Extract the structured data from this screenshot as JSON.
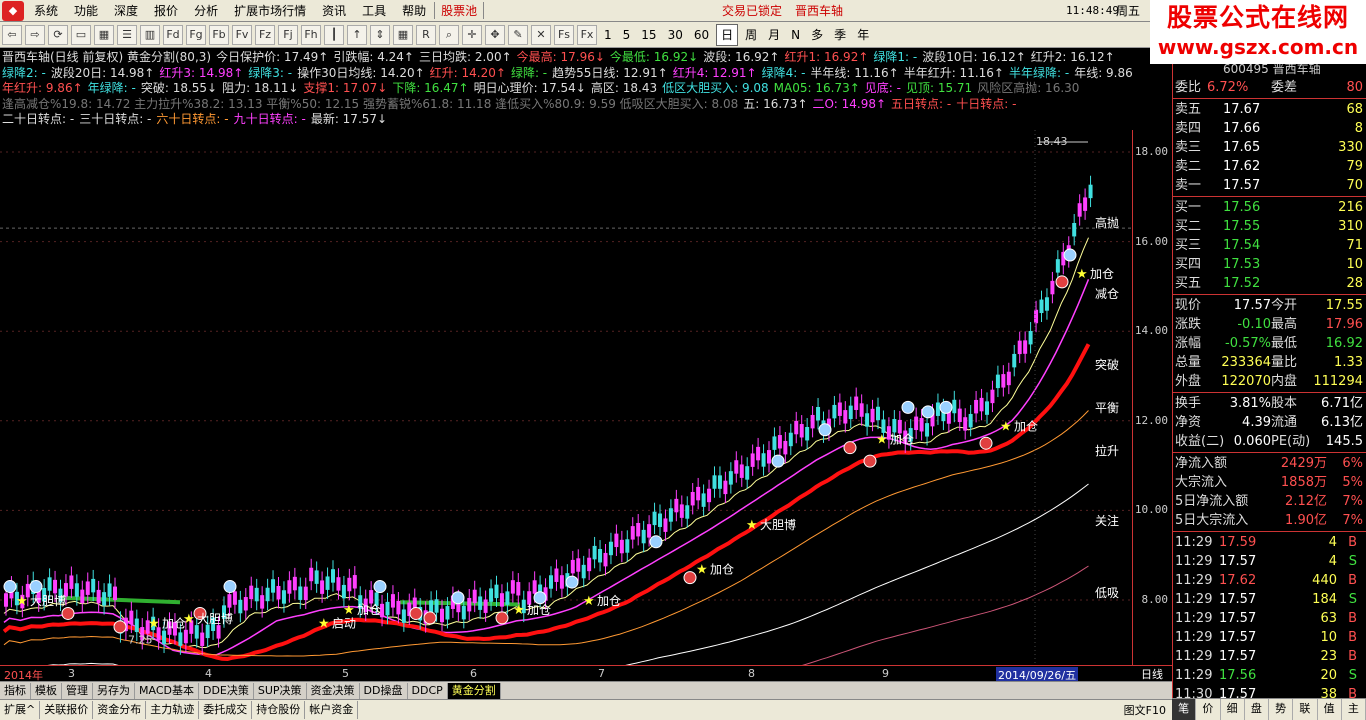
{
  "menubar": {
    "items": [
      "系统",
      "功能",
      "深度",
      "报价",
      "分析",
      "扩展市场行情",
      "资讯",
      "工具",
      "帮助"
    ],
    "stock_pool": "股票池",
    "trade_lock": "交易已锁定",
    "stock_name": "晋西车轴",
    "clock": "11:48:49",
    "weekday": "周五"
  },
  "brand": {
    "line1": "股票公式在线网",
    "line2": "www.gszx.com.cn",
    "code": "600495 晋西车轴"
  },
  "toolbar": {
    "icons": [
      "back-icon",
      "forward-icon",
      "refresh-icon",
      "window-icon",
      "grid-icon",
      "list-icon",
      "chart-icon",
      "fd-icon",
      "fg-icon",
      "fb-icon",
      "fv-icon",
      "fz-icon",
      "fj-icon",
      "fh-icon",
      "candle-icon",
      "up-arrow-icon",
      "scale-icon",
      "grid4-icon",
      "rsi-icon",
      "magnify-icon",
      "cross-icon",
      "move-icon",
      "pencil-icon",
      "x-icon",
      "fs-icon",
      "fx-icon"
    ],
    "periods": [
      "1",
      "5",
      "15",
      "30",
      "60",
      "日",
      "周",
      "月",
      "N",
      "多",
      "季",
      "年"
    ],
    "selected_period": "日"
  },
  "header": {
    "line1": [
      [
        "w",
        "晋西车轴(日线 前复权) 黄金分割(80,3)"
      ],
      [
        "w",
        "今日保护价: 17.49↑"
      ],
      [
        "w",
        "引跌幅: 4.24↑"
      ],
      [
        "w",
        "三日均跌: 2.00↑"
      ],
      [
        "r",
        "今最高: 17.96↓"
      ],
      [
        "g",
        "今最低: 16.92↓"
      ],
      [
        "w",
        "波段: 16.92↑"
      ],
      [
        "r",
        "红升1: 16.92↑"
      ],
      [
        "c",
        "绿降1: -"
      ],
      [
        "w",
        "波段10日: 16.12↑"
      ],
      [
        "w",
        "红升2: 16.12↑"
      ]
    ],
    "line2": [
      [
        "c",
        "绿降2: -"
      ],
      [
        "w",
        "波段20日: 14.98↑"
      ],
      [
        "m",
        "红升3: 14.98↑"
      ],
      [
        "c",
        "绿降3: -"
      ],
      [
        "w",
        "操作30日均线: 14.20↑"
      ],
      [
        "r",
        "红升: 14.20↑"
      ],
      [
        "g",
        "绿降: -"
      ],
      [
        "w",
        "趋势55日线: 12.91↑"
      ],
      [
        "m",
        "红升4: 12.91↑"
      ],
      [
        "c",
        "绿降4: -"
      ],
      [
        "w",
        "半年线: 11.16↑"
      ],
      [
        "w",
        "半年红升: 11.16↑"
      ],
      [
        "c",
        "半年绿降: -"
      ],
      [
        "w",
        "年线: 9.86"
      ]
    ],
    "line3": [
      [
        "r",
        "年红升: 9.86↑"
      ],
      [
        "c",
        "年绿降: -"
      ],
      [
        "w",
        "突破: 18.55↓"
      ],
      [
        "w",
        "阻力: 18.11↓"
      ],
      [
        "r",
        "支撑1: 17.07↓"
      ],
      [
        "g",
        "下降: 16.47↑"
      ],
      [
        "w",
        "明日心理价: 17.54↓"
      ],
      [
        "w",
        "高区: 18.43"
      ],
      [
        "c",
        "低区大胆买入: 9.08"
      ],
      [
        "g",
        "MA05: 16.73↑"
      ],
      [
        "m",
        "见底: -"
      ],
      [
        "g",
        "见顶: 15.71"
      ],
      [
        "gr",
        "风险区高抛: 16.30"
      ]
    ],
    "line4": [
      [
        "gr",
        "逢高减仓%19.8: 14.72 主力拉升%38.2: 13.13 平衡%50: 12.15 强势蓄锐%61.8: 11.18 逢低买入%80.9: 9.59 低吸区大胆买入: 8.08"
      ],
      [
        "w",
        "五: 16.73↑"
      ],
      [
        "m",
        "二O: 14.98↑"
      ],
      [
        "r",
        "五日转点: -"
      ],
      [
        "r",
        "十日转点: -"
      ]
    ],
    "line5": [
      [
        "w",
        "二十日转点: -"
      ],
      [
        "w",
        "三十日转点: -"
      ],
      [
        "o",
        "六十日转点: -"
      ],
      [
        "m",
        "九十日转点: -"
      ],
      [
        "w",
        "最新: 17.57↓"
      ]
    ]
  },
  "chart": {
    "price_ticks": [
      "18.00",
      "16.00",
      "14.00",
      "12.00",
      "10.00",
      "8.00"
    ],
    "levels": [
      "高抛",
      "减仓",
      "突破",
      "平衡",
      "拉升",
      "关注",
      "低吸"
    ],
    "peak_label": "18.43",
    "low_label": "7.25",
    "annotations": [
      "加仓",
      "大胆博",
      "加仓",
      "加仓",
      "加仓",
      "加仓",
      "大胆博",
      "加仓",
      "加仓",
      "加仓",
      "大胆博",
      "启动"
    ],
    "x_labels": [
      "2014年",
      "3",
      "4",
      "5",
      "6",
      "7",
      "8",
      "9"
    ],
    "cursor_date": "2014/09/26/五",
    "day_label": "日线"
  },
  "tabs1": [
    "指标",
    "模板",
    "管理",
    "另存为",
    "MACD基本",
    "DDE决策",
    "SUP决策",
    "资金决策",
    "DD操盘",
    "DDCP",
    "黄金分割"
  ],
  "tabs1_selected": "黄金分割",
  "tabs2": [
    "扩展^",
    "关联报价",
    "资金分布",
    "主力轨迹",
    "委托成交",
    "持仓股份",
    "帐户资金"
  ],
  "tabs2_right": "图文F10",
  "panel": {
    "weibi": {
      "l1": "委比",
      "v1": "6.72%",
      "l2": "委差",
      "v2": "80"
    },
    "sells": [
      [
        "卖五",
        "17.67",
        "68"
      ],
      [
        "卖四",
        "17.66",
        "8"
      ],
      [
        "卖三",
        "17.65",
        "330"
      ],
      [
        "卖二",
        "17.62",
        "79"
      ],
      [
        "卖一",
        "17.57",
        "70"
      ]
    ],
    "buys": [
      [
        "买一",
        "17.56",
        "216"
      ],
      [
        "买二",
        "17.55",
        "310"
      ],
      [
        "买三",
        "17.54",
        "71"
      ],
      [
        "买四",
        "17.53",
        "10"
      ],
      [
        "买五",
        "17.52",
        "28"
      ]
    ],
    "quote": [
      [
        "现价",
        "17.57",
        "今开",
        "17.55"
      ],
      [
        "涨跌",
        "-0.10",
        "最高",
        "17.96"
      ],
      [
        "涨幅",
        "-0.57%",
        "最低",
        "16.92"
      ],
      [
        "总量",
        "233364",
        "量比",
        "1.33"
      ],
      [
        "外盘",
        "122070",
        "内盘",
        "111294"
      ]
    ],
    "fund": [
      [
        "换手",
        "3.81%",
        "股本",
        "6.71亿"
      ],
      [
        "净资",
        "4.39",
        "流通",
        "6.13亿"
      ],
      [
        "收益(二)",
        "0.060",
        "PE(动)",
        "145.5"
      ]
    ],
    "flows": [
      [
        "净流入额",
        "2429万",
        "6%"
      ],
      [
        "大宗流入",
        "1858万",
        "5%"
      ],
      [
        "5日净流入额",
        "2.12亿",
        "7%"
      ],
      [
        "5日大宗流入",
        "1.90亿",
        "7%"
      ]
    ],
    "ticks": [
      [
        "11:29",
        "17.59",
        "4",
        "B"
      ],
      [
        "11:29",
        "17.57",
        "4",
        "S"
      ],
      [
        "11:29",
        "17.62",
        "440",
        "B"
      ],
      [
        "11:29",
        "17.57",
        "184",
        "S"
      ],
      [
        "11:29",
        "17.57",
        "63",
        "B"
      ],
      [
        "11:29",
        "17.57",
        "10",
        "B"
      ],
      [
        "11:29",
        "17.57",
        "23",
        "B"
      ],
      [
        "11:29",
        "17.56",
        "20",
        "S"
      ],
      [
        "11:30",
        "17.57",
        "38",
        "B"
      ]
    ],
    "tabs": [
      "笔",
      "价",
      "细",
      "盘",
      "势",
      "联",
      "值",
      "主"
    ],
    "tab_selected": "笔"
  },
  "colors": {
    "up": "#ff40ff",
    "down": "#40e0e0",
    "ma_red": "#ff1010",
    "accent": "#ff5050"
  }
}
